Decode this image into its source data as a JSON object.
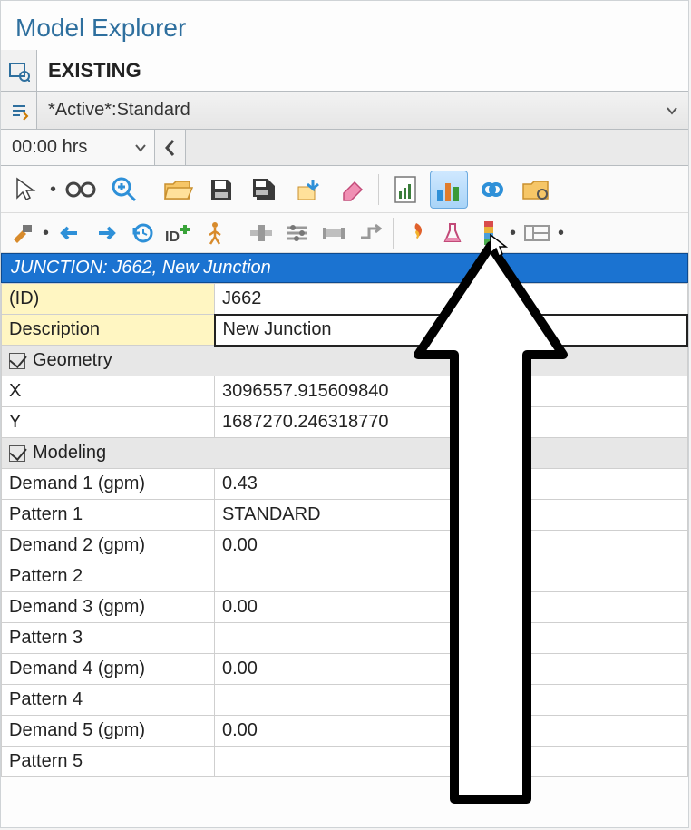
{
  "panel": {
    "title": "Model Explorer"
  },
  "scenario": {
    "name": "EXISTING"
  },
  "selection_set": {
    "name": "*Active*:Standard"
  },
  "time": {
    "value": "00:00 hrs"
  },
  "entity": {
    "header": "JUNCTION: J662, New Junction",
    "id_label": "(ID)",
    "id": "J662",
    "description_label": "Description",
    "description": "New Junction"
  },
  "sections": {
    "geometry": "Geometry",
    "modeling": "Modeling"
  },
  "geometry": {
    "x_label": "X",
    "x": "3096557.915609840",
    "y_label": "Y",
    "y": "1687270.246318770"
  },
  "modeling": {
    "d1_label": "Demand 1 (gpm)",
    "d1": "0.43",
    "p1_label": "Pattern 1",
    "p1": "STANDARD",
    "d2_label": "Demand 2 (gpm)",
    "d2": "0.00",
    "p2_label": "Pattern 2",
    "p2": "",
    "d3_label": "Demand 3 (gpm)",
    "d3": "0.00",
    "p3_label": "Pattern 3",
    "p3": "",
    "d4_label": "Demand 4 (gpm)",
    "d4": "0.00",
    "p4_label": "Pattern 4",
    "p4": "",
    "d5_label": "Demand 5 (gpm)",
    "d5": "0.00",
    "p5_label": "Pattern 5",
    "p5": ""
  }
}
